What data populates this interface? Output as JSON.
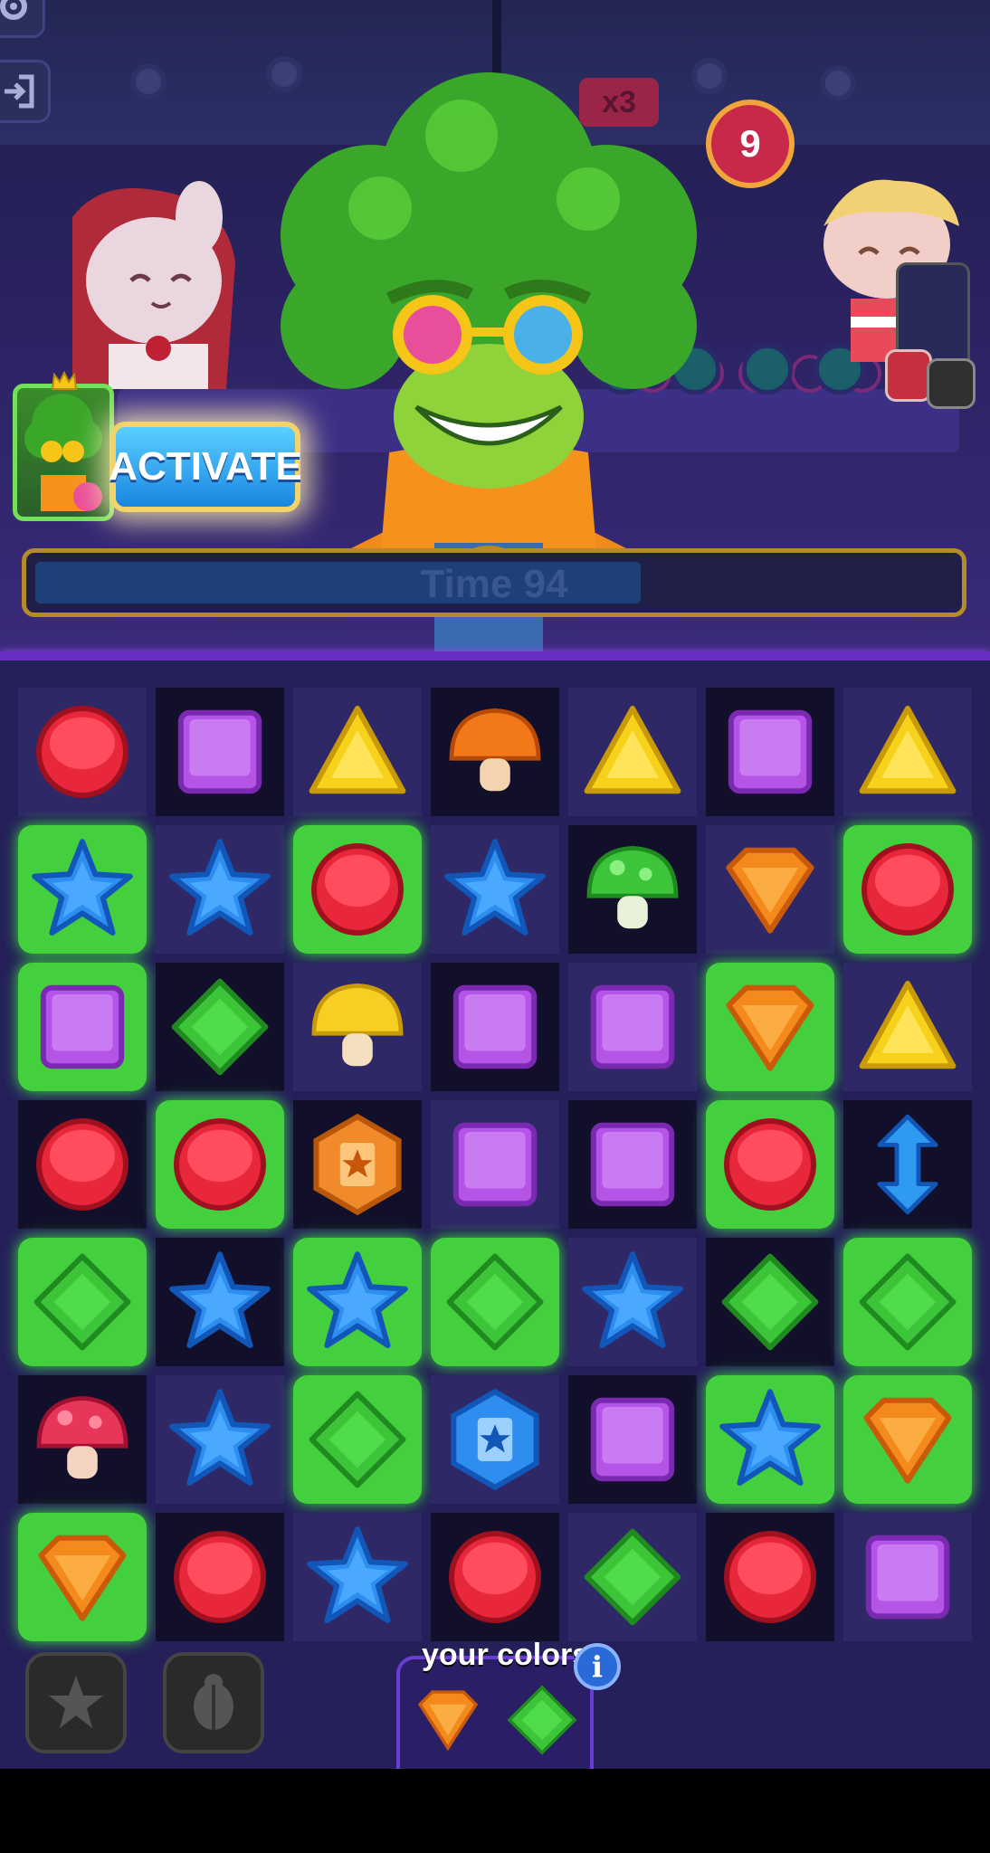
{
  "hud": {
    "multiplier": "x3",
    "moves_left": "9",
    "timer_label": "Time 94",
    "timer_fill_fraction": 0.66
  },
  "activate": {
    "label": "ACTIVATE"
  },
  "board": {
    "rows": [
      [
        {
          "piece": "red-circle",
          "bg": "light",
          "hl": false
        },
        {
          "piece": "purple-square",
          "bg": "dark",
          "hl": false
        },
        {
          "piece": "yellow-triangle",
          "bg": "light",
          "hl": false
        },
        {
          "piece": "orange-mushroom",
          "bg": "dark",
          "hl": false
        },
        {
          "piece": "yellow-triangle",
          "bg": "light",
          "hl": false
        },
        {
          "piece": "purple-square",
          "bg": "dark",
          "hl": false
        },
        {
          "piece": "yellow-triangle",
          "bg": "light",
          "hl": false
        }
      ],
      [
        {
          "piece": "blue-star",
          "bg": "dark",
          "hl": true
        },
        {
          "piece": "blue-star",
          "bg": "light",
          "hl": false
        },
        {
          "piece": "red-circle",
          "bg": "dark",
          "hl": true
        },
        {
          "piece": "blue-star",
          "bg": "light",
          "hl": false
        },
        {
          "piece": "green-mushroom",
          "bg": "dark",
          "hl": false
        },
        {
          "piece": "orange-gem",
          "bg": "light",
          "hl": false
        },
        {
          "piece": "red-circle",
          "bg": "dark",
          "hl": true
        }
      ],
      [
        {
          "piece": "purple-square",
          "bg": "light",
          "hl": true
        },
        {
          "piece": "green-diamond",
          "bg": "dark",
          "hl": false
        },
        {
          "piece": "yellow-mushroom",
          "bg": "light",
          "hl": false
        },
        {
          "piece": "purple-square",
          "bg": "dark",
          "hl": false
        },
        {
          "piece": "purple-square",
          "bg": "light",
          "hl": false
        },
        {
          "piece": "orange-gem",
          "bg": "dark",
          "hl": true
        },
        {
          "piece": "yellow-triangle",
          "bg": "light",
          "hl": false
        }
      ],
      [
        {
          "piece": "red-circle",
          "bg": "dark",
          "hl": false
        },
        {
          "piece": "red-circle",
          "bg": "light",
          "hl": true
        },
        {
          "piece": "orange-book-token",
          "bg": "dark",
          "hl": false
        },
        {
          "piece": "purple-square",
          "bg": "light",
          "hl": false
        },
        {
          "piece": "purple-square",
          "bg": "dark",
          "hl": false
        },
        {
          "piece": "red-circle",
          "bg": "light",
          "hl": true
        },
        {
          "piece": "blue-vertical-arrow",
          "bg": "dark",
          "hl": false
        }
      ],
      [
        {
          "piece": "green-diamond",
          "bg": "light",
          "hl": true
        },
        {
          "piece": "blue-star",
          "bg": "dark",
          "hl": false
        },
        {
          "piece": "blue-star",
          "bg": "light",
          "hl": true
        },
        {
          "piece": "green-diamond",
          "bg": "dark",
          "hl": true
        },
        {
          "piece": "blue-star",
          "bg": "light",
          "hl": false
        },
        {
          "piece": "green-diamond",
          "bg": "dark",
          "hl": false
        },
        {
          "piece": "green-diamond",
          "bg": "light",
          "hl": true
        }
      ],
      [
        {
          "piece": "red-mushroom",
          "bg": "dark",
          "hl": false
        },
        {
          "piece": "blue-star",
          "bg": "light",
          "hl": false
        },
        {
          "piece": "green-diamond",
          "bg": "dark",
          "hl": true
        },
        {
          "piece": "blue-book-token",
          "bg": "light",
          "hl": false
        },
        {
          "piece": "purple-square",
          "bg": "dark",
          "hl": false
        },
        {
          "piece": "blue-star",
          "bg": "light",
          "hl": true
        },
        {
          "piece": "orange-gem",
          "bg": "dark",
          "hl": true
        }
      ],
      [
        {
          "piece": "orange-gem",
          "bg": "light",
          "hl": true
        },
        {
          "piece": "red-circle",
          "bg": "dark",
          "hl": false
        },
        {
          "piece": "blue-star",
          "bg": "light",
          "hl": false
        },
        {
          "piece": "red-circle",
          "bg": "dark",
          "hl": false
        },
        {
          "piece": "green-diamond",
          "bg": "light",
          "hl": false
        },
        {
          "piece": "red-circle",
          "bg": "dark",
          "hl": false
        },
        {
          "piece": "purple-square",
          "bg": "light",
          "hl": false
        }
      ]
    ]
  },
  "your_colors": {
    "label": "your colors",
    "info": "i",
    "pieces": [
      "orange-gem",
      "green-diamond"
    ]
  },
  "icons": {
    "settings": "gear-icon",
    "exit": "exit-icon",
    "powerup_1": "star-powerup-icon",
    "powerup_2": "scarab-powerup-icon"
  },
  "colors": {
    "highlight": "#44cf3f",
    "accent": "#6a2fc0",
    "timer_border": "#b48b2b"
  }
}
